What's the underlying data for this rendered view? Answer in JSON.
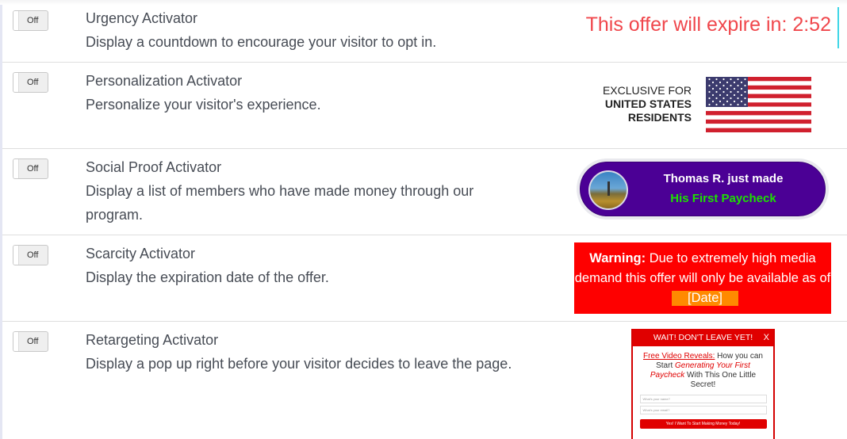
{
  "activators": [
    {
      "id": "urgency",
      "toggle_label": "Off",
      "title": "Urgency Activator",
      "description": "Display a countdown to encourage your visitor to opt in.",
      "preview": {
        "text": "This offer will expire in: 2:52",
        "color": "#f0474c"
      }
    },
    {
      "id": "personalization",
      "toggle_label": "Off",
      "title": "Personalization Activator",
      "description": "Personalize your visitor's experience.",
      "preview": {
        "line1": "EXCLUSIVE FOR",
        "line2": "UNITED STATES",
        "line3": "RESIDENTS",
        "flag": "us-flag"
      }
    },
    {
      "id": "social-proof",
      "toggle_label": "Off",
      "title": "Social Proof Activator",
      "description": "Display a list of members who have made money through our program.",
      "preview": {
        "line1": "Thomas R. just made",
        "line2": "His First Paycheck",
        "bg_color": "#4b0095",
        "accent_color": "#1ee000"
      }
    },
    {
      "id": "scarcity",
      "toggle_label": "Off",
      "title": "Scarcity Activator",
      "description": "Display the expiration date of the offer.",
      "preview": {
        "bold": "Warning:",
        "text": " Due to extremely high media demand this offer will only be available as of",
        "date_placeholder": "[Date]",
        "bg_color": "#fe0000",
        "date_color": "#ff8a00"
      }
    },
    {
      "id": "retargeting",
      "toggle_label": "Off",
      "title": "Retargeting Activator",
      "description": "Display a pop up right before your visitor decides to leave the page.",
      "preview": {
        "header": "WAIT! DON'T LEAVE YET!",
        "close": "X",
        "link_text": "Free Video Reveals:",
        "text1": " How you can Start ",
        "emphasis": "Generating Your First Paycheck",
        "text2": " With This One Little Secret!",
        "name_placeholder": "What's your name?",
        "email_placeholder": "What's your email?",
        "button": "Yes! I Want To Start Making Money Today!"
      }
    }
  ]
}
